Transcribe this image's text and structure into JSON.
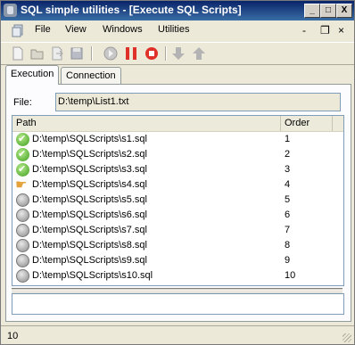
{
  "window": {
    "title": "SQL simple utilities - [Execute SQL Scripts]"
  },
  "titlebar_buttons": {
    "minimize": "_",
    "maximize": "□",
    "close": "X"
  },
  "menu": {
    "items": [
      "File",
      "View",
      "Windows",
      "Utilities"
    ],
    "mdi": {
      "minimize": "-",
      "restore": "❐",
      "close": "×"
    }
  },
  "toolbar": {
    "icons": [
      "new-file-icon",
      "open-folder-icon",
      "export-icon",
      "save-icon",
      "run-icon",
      "pause-icon",
      "stop-icon",
      "move-down-icon",
      "move-up-icon"
    ]
  },
  "tabs": [
    "Execution",
    "Connection"
  ],
  "file": {
    "label": "File:",
    "value": "D:\\temp\\List1.txt"
  },
  "list": {
    "headers": {
      "path": "Path",
      "order": "Order"
    },
    "rows": [
      {
        "status": "done",
        "path": "D:\\temp\\SQLScripts\\s1.sql",
        "order": "1"
      },
      {
        "status": "done",
        "path": "D:\\temp\\SQLScripts\\s2.sql",
        "order": "2"
      },
      {
        "status": "done",
        "path": "D:\\temp\\SQLScripts\\s3.sql",
        "order": "3"
      },
      {
        "status": "current",
        "path": "D:\\temp\\SQLScripts\\s4.sql",
        "order": "4"
      },
      {
        "status": "pending",
        "path": "D:\\temp\\SQLScripts\\s5.sql",
        "order": "5"
      },
      {
        "status": "pending",
        "path": "D:\\temp\\SQLScripts\\s6.sql",
        "order": "6"
      },
      {
        "status": "pending",
        "path": "D:\\temp\\SQLScripts\\s7.sql",
        "order": "7"
      },
      {
        "status": "pending",
        "path": "D:\\temp\\SQLScripts\\s8.sql",
        "order": "8"
      },
      {
        "status": "pending",
        "path": "D:\\temp\\SQLScripts\\s9.sql",
        "order": "9"
      },
      {
        "status": "pending",
        "path": "D:\\temp\\SQLScripts\\s10.sql",
        "order": "10"
      }
    ]
  },
  "statusbar": {
    "text": "10"
  },
  "colors": {
    "titlebar": "#0a246a",
    "done": "#3f9d1f",
    "current": "#e5a23a",
    "pending": "#8c8c8c"
  }
}
